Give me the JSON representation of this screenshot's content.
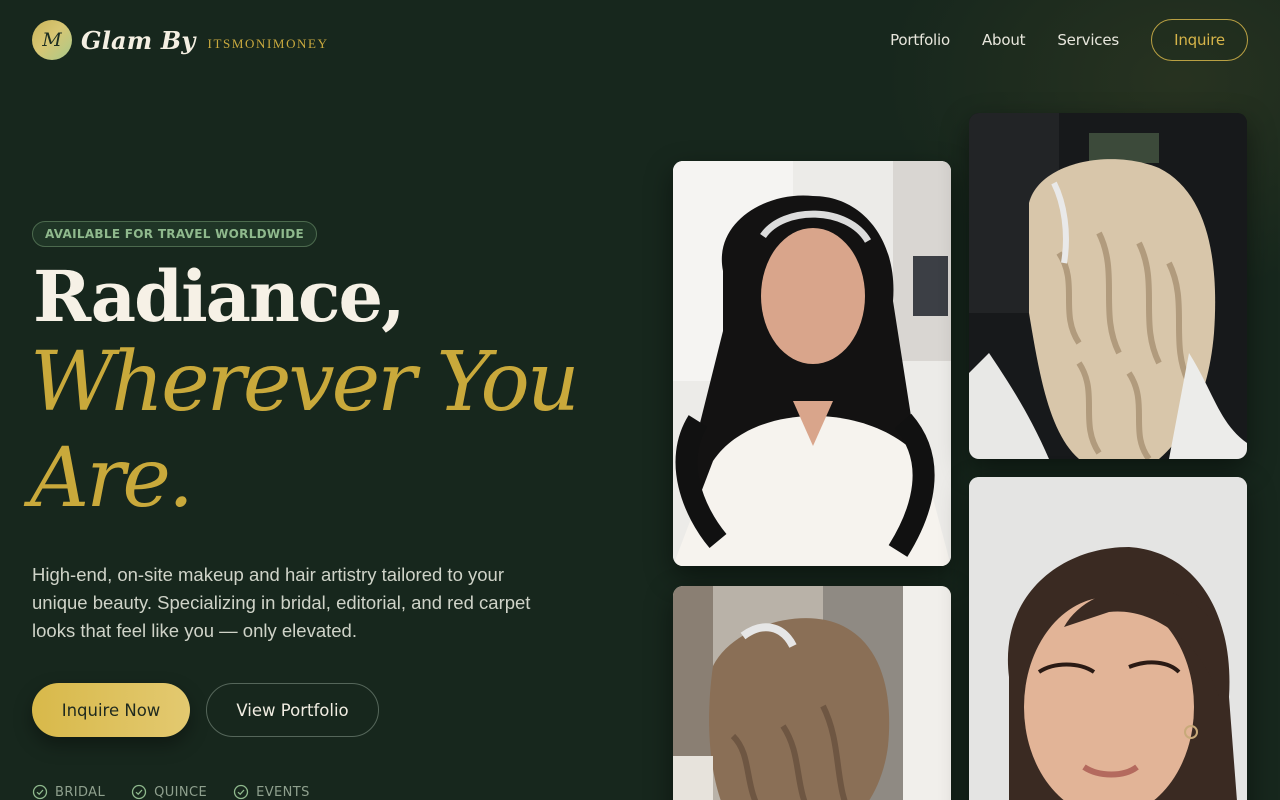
{
  "brand": {
    "monogram": "M",
    "name": "Glam By",
    "subname": "ITSMONIMONEY"
  },
  "nav": {
    "items": [
      "Portfolio",
      "About",
      "Services"
    ],
    "cta": "Inquire"
  },
  "hero": {
    "badge": "AVAILABLE FOR TRAVEL WORLDWIDE",
    "headline": "Radiance,",
    "script_line_1": "Wherever You",
    "script_line_2": "Are.",
    "description": "High-end, on-site makeup and hair artistry tailored to your unique beauty. Specializing in bridal, editorial, and red carpet looks that feel like you — only elevated.",
    "primary_button": "Inquire Now",
    "secondary_button": "View Portfolio",
    "features": [
      "BRIDAL",
      "QUINCE",
      "EVENTS"
    ]
  },
  "gallery": {
    "photos": [
      {
        "subject": "bride-dark-curls"
      },
      {
        "subject": "blonde-curls-back"
      },
      {
        "subject": "updo-tiara-side"
      },
      {
        "subject": "closeup-makeup"
      }
    ]
  },
  "colors": {
    "background": "#17271d",
    "accent_gold": "#c9a93b",
    "badge_green": "#8fb98d",
    "text_light": "#f6f1e6"
  },
  "icons": {
    "feature_check": "check-circle-icon"
  }
}
